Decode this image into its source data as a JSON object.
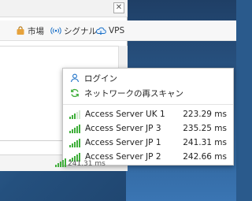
{
  "toolbar": {
    "market": "市場",
    "signal": "シグナル",
    "vps": "VPS"
  },
  "menu": {
    "login": "ログイン",
    "rescan": "ネットワークの再スキャン"
  },
  "servers": [
    {
      "name": "Access Server UK 1",
      "ping": "223.29 ms"
    },
    {
      "name": "Access Server JP 3",
      "ping": "235.25 ms"
    },
    {
      "name": "Access Server JP 1",
      "ping": "241.31 ms"
    },
    {
      "name": "Access Server JP 2",
      "ping": "242.66 ms"
    }
  ],
  "tray": {
    "ping_text": "241.31 ms"
  },
  "colors": {
    "accent": "#1e72c8",
    "signal_green": "#3fae3a"
  }
}
